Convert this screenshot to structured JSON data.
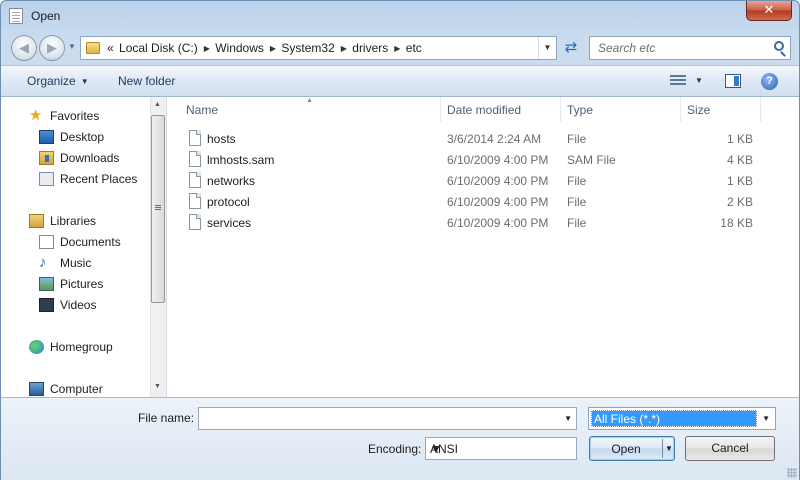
{
  "window": {
    "title": "Open",
    "close_label": "✕"
  },
  "nav": {
    "breadcrumb_prefix": "«",
    "breadcrumb": [
      "Local Disk (C:)",
      "Windows",
      "System32",
      "drivers",
      "etc"
    ],
    "search_placeholder": "Search etc"
  },
  "toolbar": {
    "organize_label": "Organize",
    "new_folder_label": "New folder",
    "help_label": "?"
  },
  "sidebar": {
    "favorites": "Favorites",
    "desktop": "Desktop",
    "downloads": "Downloads",
    "recent_places": "Recent Places",
    "libraries": "Libraries",
    "documents": "Documents",
    "music": "Music",
    "pictures": "Pictures",
    "videos": "Videos",
    "homegroup": "Homegroup",
    "computer": "Computer"
  },
  "columns": {
    "name": "Name",
    "date_modified": "Date modified",
    "type": "Type",
    "size": "Size"
  },
  "files": [
    {
      "name": "hosts",
      "date": "3/6/2014 2:24 AM",
      "type": "File",
      "size": "1 KB"
    },
    {
      "name": "lmhosts.sam",
      "date": "6/10/2009 4:00 PM",
      "type": "SAM File",
      "size": "4 KB"
    },
    {
      "name": "networks",
      "date": "6/10/2009 4:00 PM",
      "type": "File",
      "size": "1 KB"
    },
    {
      "name": "protocol",
      "date": "6/10/2009 4:00 PM",
      "type": "File",
      "size": "2 KB"
    },
    {
      "name": "services",
      "date": "6/10/2009 4:00 PM",
      "type": "File",
      "size": "18 KB"
    }
  ],
  "bottom": {
    "file_name_label": "File name:",
    "file_name_value": "",
    "filter_value": "All Files  (*.*)",
    "encoding_label": "Encoding:",
    "encoding_value": "ANSI",
    "open_label": "Open",
    "cancel_label": "Cancel"
  }
}
